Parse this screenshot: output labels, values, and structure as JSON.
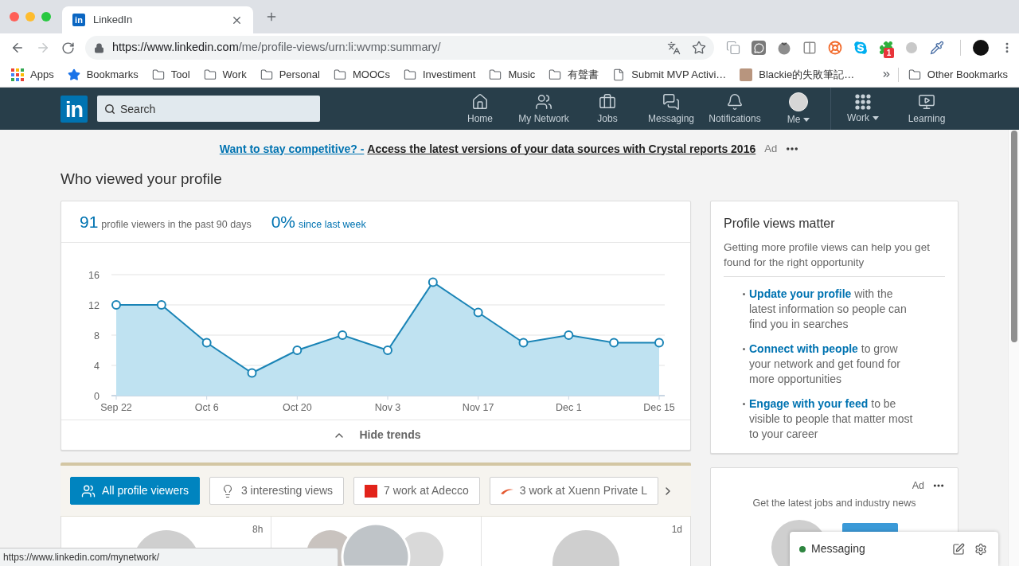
{
  "browser": {
    "tab": {
      "favicon": "in",
      "title": "LinkedIn"
    },
    "address_bar": {
      "host": "https://www.linkedin.com",
      "path": "/me/profile-views/urn:li:wvmp:summary/"
    },
    "extension_badge": "1",
    "bookmarks": [
      {
        "kind": "apps",
        "label": "Apps"
      },
      {
        "kind": "star",
        "label": "Bookmarks"
      },
      {
        "kind": "folder",
        "label": "Tool"
      },
      {
        "kind": "folder",
        "label": "Work"
      },
      {
        "kind": "folder",
        "label": "Personal"
      },
      {
        "kind": "folder",
        "label": "MOOCs"
      },
      {
        "kind": "folder",
        "label": "Investiment"
      },
      {
        "kind": "folder",
        "label": "Music"
      },
      {
        "kind": "folder",
        "label": "有聲書"
      },
      {
        "kind": "page",
        "label": "Submit MVP Activi…"
      },
      {
        "kind": "photo",
        "label": "Blackie的失敗筆記…"
      }
    ],
    "other_bookmarks": {
      "kind": "folder",
      "label": "Other Bookmarks"
    },
    "status_url": "https://www.linkedin.com/mynetwork/"
  },
  "site": {
    "logo": "in",
    "search": {
      "placeholder": "Search"
    },
    "nav": {
      "main": [
        {
          "kind": "home",
          "label": "Home",
          "selected": false,
          "menu": false
        },
        {
          "kind": "network",
          "label": "My Network",
          "selected": false,
          "menu": false
        },
        {
          "kind": "jobs",
          "label": "Jobs",
          "selected": false,
          "menu": false
        },
        {
          "kind": "messaging",
          "label": "Messaging",
          "selected": false,
          "menu": false
        },
        {
          "kind": "notifications",
          "label": "Notifications",
          "selected": false,
          "menu": false
        },
        {
          "kind": "me",
          "label": "Me",
          "selected": false,
          "menu": true
        }
      ],
      "extra": [
        {
          "kind": "work",
          "label": "Work",
          "selected": false,
          "menu": true
        },
        {
          "kind": "learning",
          "label": "Learning",
          "selected": false,
          "menu": false
        }
      ]
    }
  },
  "ad_banner": {
    "link": "Want to stay competitive? -",
    "headline": "Access the latest versions of your data sources with Crystal reports 2016",
    "label": "Ad"
  },
  "page_title": "Who viewed your profile",
  "profile_views": {
    "stats": [
      {
        "kind": "count",
        "value": "91",
        "label": "profile viewers in the past 90 days"
      },
      {
        "kind": "change",
        "value": "0%",
        "label": "since last week"
      }
    ],
    "chart_data": {
      "type": "area",
      "categories": [
        "Sep 22",
        null,
        "Oct 6",
        null,
        "Oct 20",
        null,
        "Nov 3",
        null,
        "Nov 17",
        null,
        "Dec 1",
        null,
        "Dec 15"
      ],
      "values": [
        12,
        12,
        7,
        3,
        6,
        8,
        6,
        15,
        11,
        7,
        8,
        7,
        7
      ],
      "ylim": [
        0,
        16
      ],
      "yticks": [
        0,
        4,
        8,
        12,
        16
      ],
      "grid": true
    },
    "toggle": "Hide trends"
  },
  "viewers_panel": {
    "filters": [
      {
        "kind": "viewers",
        "label": "All profile viewers",
        "selected": true
      },
      {
        "kind": "insights",
        "label": "3 interesting views",
        "selected": false
      },
      {
        "kind": "company_square",
        "label": "7 work at Adecco",
        "selected": false
      },
      {
        "kind": "company_swoosh",
        "label": "3 work at Xuenn Private L",
        "selected": false
      }
    ],
    "viewers": [
      {
        "kind": "single",
        "time": "8h"
      },
      {
        "kind": "group"
      },
      {
        "kind": "single",
        "time": "1d"
      }
    ]
  },
  "sidebar": {
    "title": "Profile views matter",
    "description": "Getting more profile views can help you get found for the right opportunity",
    "tips": [
      {
        "link": "Update your profile",
        "text": "with the latest information so people can find you in searches"
      },
      {
        "link": "Connect with people",
        "text": "to grow your network and get found for more opportunities"
      },
      {
        "link": "Engage with your feed",
        "text": "to be visible to people that matter most to your career"
      }
    ]
  },
  "ad_card": {
    "label": "Ad",
    "text": "Get the latest jobs and industry news"
  },
  "messaging": {
    "label": "Messaging",
    "online": true
  }
}
